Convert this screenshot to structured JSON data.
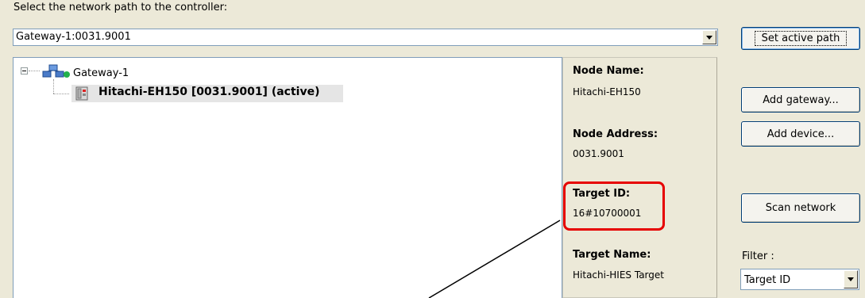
{
  "prompt": "Select the network path to the controller:",
  "path_combo": {
    "value": "Gateway-1:0031.9001"
  },
  "buttons": {
    "set_active_path": "Set active path",
    "add_gateway": "Add gateway...",
    "add_device": "Add device...",
    "scan_network": "Scan network"
  },
  "tree": {
    "gateway": "Gateway-1",
    "device": "Hitachi-EH150 [0031.9001] (active)"
  },
  "info": {
    "node_name_label": "Node Name:",
    "node_name_value": "Hitachi-EH150",
    "node_address_label": "Node Address:",
    "node_address_value": "0031.9001",
    "target_id_label": "Target ID:",
    "target_id_value": "16#10700001",
    "target_name_label": "Target Name:",
    "target_name_value": "Hitachi-HIES Target"
  },
  "filter": {
    "label": "Filter :",
    "value": "Target ID"
  },
  "colors": {
    "window_bg": "#ece9d8",
    "highlight": "#e60000",
    "status_green": "#22b14c"
  },
  "icons": {
    "gateway": "network-gateway-icon",
    "device": "plc-device-icon",
    "dropdown": "chevron-down-icon"
  }
}
